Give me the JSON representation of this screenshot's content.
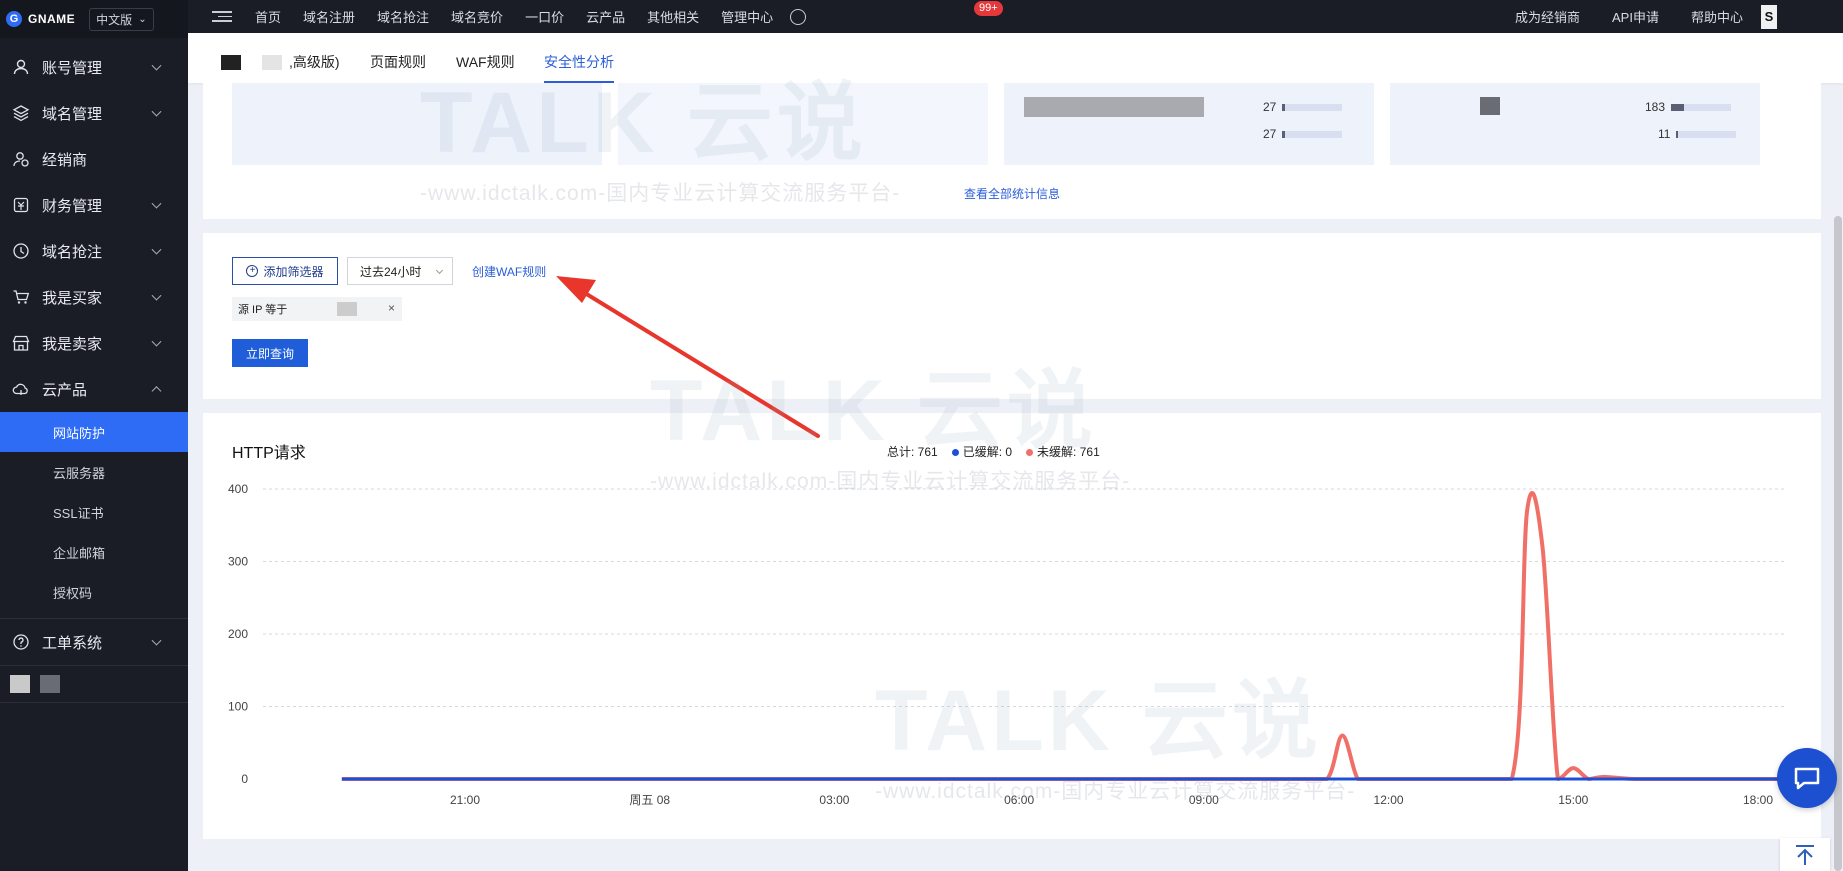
{
  "brand": {
    "name": "GNAME",
    "language": "中文版"
  },
  "sidebar": {
    "items": [
      {
        "label": "账号管理",
        "icon": "user-icon"
      },
      {
        "label": "域名管理",
        "icon": "layers-icon"
      },
      {
        "label": "经销商",
        "icon": "dealer-icon"
      },
      {
        "label": "财务管理",
        "icon": "finance-icon"
      },
      {
        "label": "域名抢注",
        "icon": "clock-icon"
      },
      {
        "label": "我是买家",
        "icon": "cart-icon"
      },
      {
        "label": "我是卖家",
        "icon": "store-icon"
      },
      {
        "label": "云产品",
        "icon": "cloud-icon"
      }
    ],
    "subitems": [
      "网站防护",
      "云服务器",
      "SSL证书",
      "企业邮箱",
      "授权码"
    ],
    "ticket": {
      "label": "工单系统",
      "icon": "help-circle-icon"
    }
  },
  "topnav": {
    "links": [
      "首页",
      "域名注册",
      "域名抢注",
      "域名竞价",
      "一口价",
      "云产品",
      "其他相关",
      "管理中心"
    ],
    "badge": "99+",
    "right": [
      "成为经销商",
      "API申请",
      "帮助中心"
    ]
  },
  "tabs": {
    "site_suffix": ",高级版)",
    "items": [
      "页面规则",
      "WAF规则",
      "安全性分析"
    ],
    "active": "安全性分析"
  },
  "stats": {
    "rows": [
      {
        "value": "27",
        "fill": 0.05
      },
      {
        "value": "27",
        "fill": 0.05
      },
      {
        "value": "183",
        "fill": 0.22
      },
      {
        "value": "11",
        "fill": 0.03
      }
    ],
    "view_all": "查看全部统计信息"
  },
  "filter": {
    "add_filter": "添加筛选器",
    "range": "过去24小时",
    "create_waf": "创建WAF规则",
    "tag": "源 IP 等于",
    "query": "立即查询"
  },
  "chart": {
    "title": "HTTP请求",
    "legend": {
      "total": "总计: 761",
      "mitigated": "已缓解: 0",
      "unmitigated": "未缓解: 761"
    },
    "colors": {
      "mitigated": "#1f4fd8",
      "unmitigated": "#f07068"
    }
  },
  "chart_data": {
    "type": "line",
    "title": "HTTP请求",
    "xlabel": "",
    "ylabel": "",
    "ylim": [
      0,
      400
    ],
    "yticks": [
      0,
      100,
      200,
      300,
      400
    ],
    "xticks": [
      "21:00",
      "周五 08",
      "03:00",
      "06:00",
      "09:00",
      "12:00",
      "15:00",
      "18:00"
    ],
    "x": [
      "19:00",
      "20:00",
      "21:00",
      "22:00",
      "23:00",
      "00:00",
      "01:00",
      "02:00",
      "03:00",
      "04:00",
      "05:00",
      "06:00",
      "07:00",
      "08:00",
      "09:00",
      "10:00",
      "10:30",
      "11:00",
      "11:15",
      "11:30",
      "11:45",
      "12:00",
      "13:00",
      "14:00",
      "14:15",
      "14:30",
      "14:45",
      "15:00",
      "15:15",
      "15:30",
      "16:00",
      "17:00",
      "18:00",
      "18:30"
    ],
    "series": [
      {
        "name": "已缓解",
        "color": "#1f4fd8",
        "values": [
          0,
          0,
          0,
          0,
          0,
          0,
          0,
          0,
          0,
          0,
          0,
          0,
          0,
          0,
          0,
          0,
          0,
          0,
          0,
          0,
          0,
          0,
          0,
          0,
          0,
          0,
          0,
          0,
          0,
          0,
          0,
          0,
          0,
          0
        ]
      },
      {
        "name": "未缓解",
        "color": "#f07068",
        "values": [
          0,
          0,
          0,
          0,
          0,
          0,
          0,
          0,
          0,
          0,
          0,
          0,
          0,
          0,
          0,
          0,
          0,
          0,
          60,
          0,
          0,
          0,
          0,
          0,
          370,
          320,
          0,
          15,
          0,
          3,
          0,
          0,
          0,
          0
        ]
      }
    ]
  },
  "watermark": {
    "brand": "TALK 云说",
    "url": "-www.idctalk.com-国内专业云计算交流服务平台-"
  }
}
